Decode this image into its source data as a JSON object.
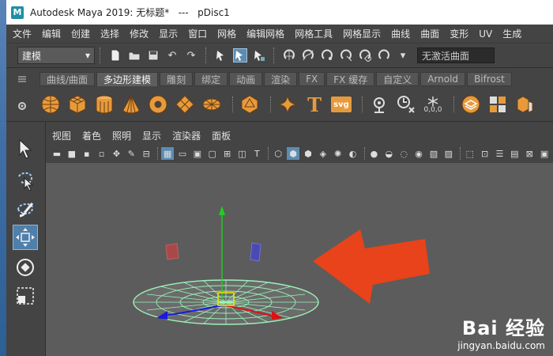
{
  "window": {
    "title": "Autodesk Maya 2019: 无标题*   ---   pDisc1",
    "logo": "M"
  },
  "menubar": [
    "文件",
    "编辑",
    "创建",
    "选择",
    "修改",
    "显示",
    "窗口",
    "网格",
    "编辑网格",
    "网格工具",
    "网格显示",
    "曲线",
    "曲面",
    "变形",
    "UV",
    "生成"
  ],
  "statusline": {
    "mode": "建模",
    "field_placeholder": "无激活曲面"
  },
  "shelf": {
    "tabs": [
      "曲线/曲面",
      "多边形建模",
      "雕刻",
      "绑定",
      "动画",
      "渲染",
      "FX",
      "FX 缓存",
      "自定义",
      "Arnold",
      "Bifrost"
    ],
    "active_tab": 1,
    "text_icon": "T",
    "svg_icon": "svg",
    "counter_icon": "0,0,0"
  },
  "panel": {
    "menu": [
      "视图",
      "着色",
      "照明",
      "显示",
      "渲染器",
      "面板"
    ]
  },
  "watermark": {
    "brand": "Bai 经验",
    "url": "jingyan.baidu.com"
  },
  "colors": {
    "accent": "#5d8cb2",
    "arrow": "#e8431a",
    "mesh": "#9cf2b8",
    "y_axis": "#22cc22",
    "x_axis": "#dd1111",
    "z_axis": "#1a1add"
  }
}
